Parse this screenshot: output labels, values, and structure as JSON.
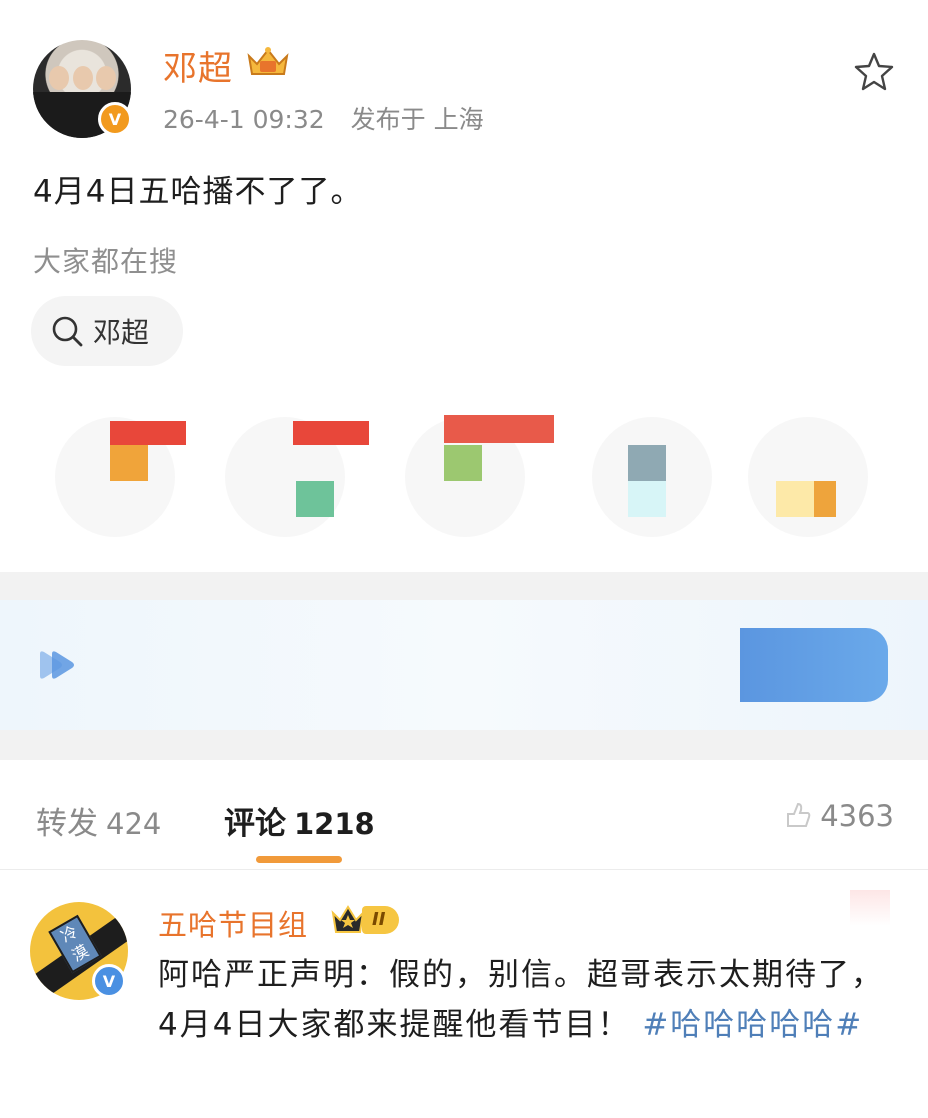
{
  "post": {
    "author": "邓超",
    "time": "26-4-1 09:32",
    "location": "发布于 上海",
    "text": "4月4日五哈播不了了。",
    "verify_mark": "V"
  },
  "search": {
    "label": "大家都在搜",
    "chip": "邓超"
  },
  "tabs": {
    "repost_label": "转发",
    "repost_count": "424",
    "comment_label": "评论",
    "comment_count": "1218",
    "like_count": "4363"
  },
  "comment": {
    "author": "五哈节目组",
    "level": "II",
    "text": "阿哈严正声明：假的，别信。超哥表示太期待了，4月4日大家都来提醒他看节目！",
    "topic": "#哈哈哈哈哈#",
    "avatar_tag": "冷漠",
    "verify_mark": "V"
  },
  "icons": [
    "crown-icon",
    "star-icon",
    "search-icon",
    "like-icon",
    "level-crown-icon"
  ],
  "colors": {
    "author": "#e8742c",
    "accent_underline": "#f19a3a",
    "topic": "#4f7fb8",
    "verify_orange": "#f29a1e",
    "verify_blue": "#4a90e2"
  }
}
